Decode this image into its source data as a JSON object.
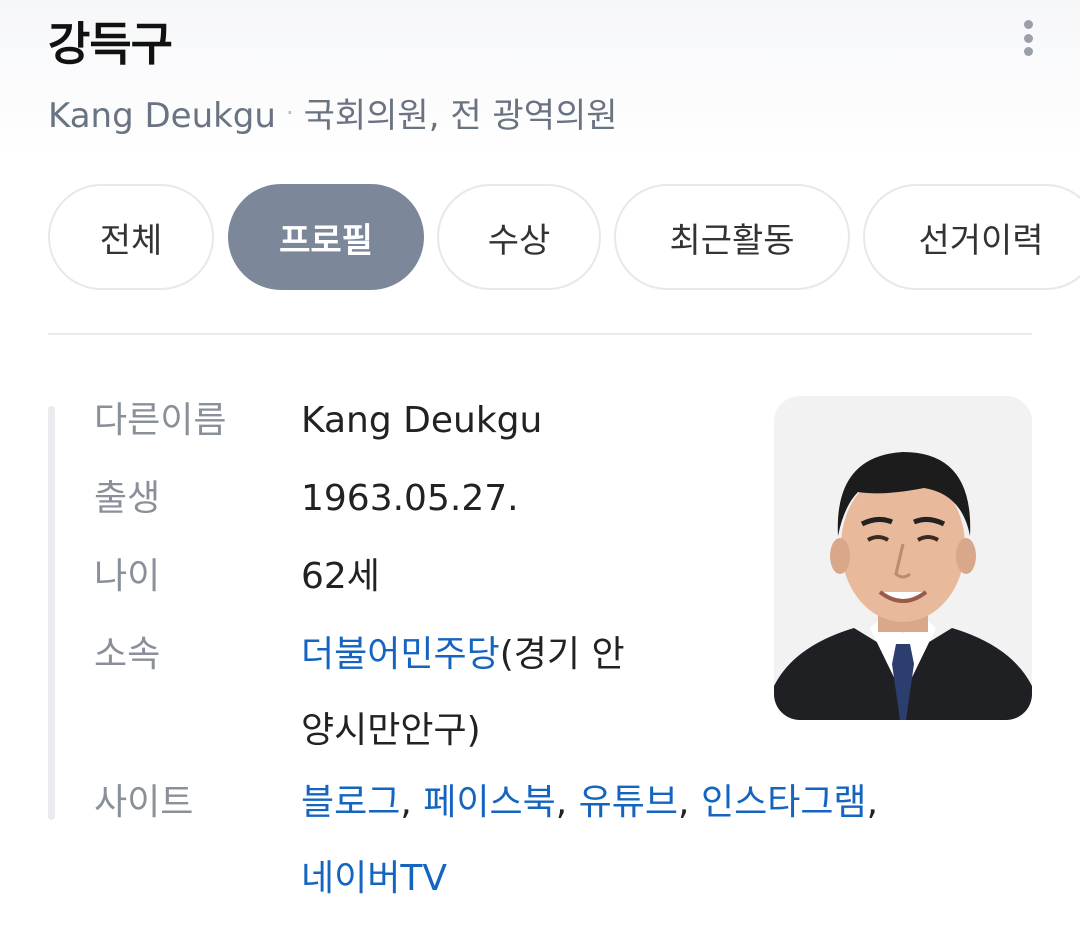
{
  "header": {
    "name": "강득구",
    "english_name": "Kang Deukgu",
    "separator": "·",
    "role": "국회의원, 전 광역의원"
  },
  "tabs": [
    {
      "label": "전체",
      "active": false
    },
    {
      "label": "프로필",
      "active": true
    },
    {
      "label": "수상",
      "active": false
    },
    {
      "label": "최근활동",
      "active": false
    },
    {
      "label": "선거이력",
      "active": false
    }
  ],
  "profile": {
    "other_name": {
      "label": "다른이름",
      "value": "Kang Deukgu"
    },
    "birth": {
      "label": "출생",
      "value": "1963.05.27."
    },
    "age": {
      "label": "나이",
      "value": "62세"
    },
    "affiliation": {
      "label": "소속",
      "party": "더불어민주당",
      "district_line1": "(경기 안",
      "district_line2": "양시만안구)"
    },
    "sites": {
      "label": "사이트",
      "links": [
        "블로그",
        "페이스북",
        "유튜브",
        "인스타그램",
        "네이버TV"
      ],
      "comma": ","
    }
  },
  "colors": {
    "link": "#1565c0",
    "active_tab": "#7c8899",
    "label": "#8a9099"
  },
  "icons": {
    "more": "more-vertical-icon"
  }
}
